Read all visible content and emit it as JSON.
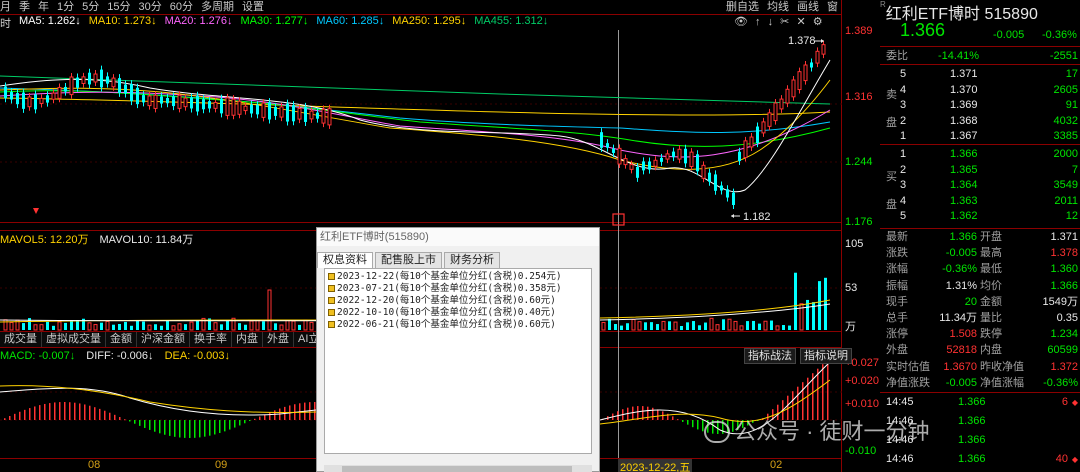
{
  "toolbar": {
    "items": [
      "月",
      "季",
      "年",
      "1分",
      "5分",
      "15分",
      "30分",
      "60分",
      "多周期",
      "设置"
    ],
    "right_items": [
      "删自选",
      "均线",
      "画线",
      "窗"
    ]
  },
  "ma": {
    "ma5": "MA5: 1.262↓",
    "ma10": "MA10: 1.273↓",
    "ma20": "MA20: 1.276↓",
    "ma30": "MA30: 1.277↓",
    "ma60": "MA60: 1.285↓",
    "ma250": "MA250: 1.295↓",
    "ma455": "MA455: 1.312↓",
    "prefix": "时",
    "colors": {
      "ma5": "#ffffff",
      "ma10": "#ffd200",
      "ma20": "#ff66ff",
      "ma30": "#00ff00",
      "ma60": "#00c8ff",
      "ma250": "#ffd200",
      "ma455": "#00cc66"
    }
  },
  "price_scale": {
    "p1": "1.389",
    "p2": "1.316",
    "p3": "1.244",
    "p4": "1.176"
  },
  "annotations": {
    "high": "1.378",
    "low": "1.182"
  },
  "volume": {
    "mavol5": "MAVOL5: 12.20万",
    "mavol10": "MAVOL10: 11.84万",
    "scale_top": "105",
    "scale_mid": "53",
    "unit": "万"
  },
  "indicator_tabs": [
    "成交量",
    "虚拟成交量",
    "金额",
    "沪深金额",
    "换手率",
    "内盘",
    "外盘",
    "AI立桩成"
  ],
  "macd": {
    "macd": "MACD: -0.007↓",
    "diff": "DIFF: -0.006↓",
    "dea": "DEA: -0.003↓",
    "btn1": "指标战法",
    "btn2": "指标说明",
    "scale": [
      "+0.027",
      "+0.020",
      "+0.010",
      "-0.010"
    ]
  },
  "date_axis": {
    "d1": "08",
    "d2": "09",
    "d3": "2023-12-22,五",
    "d4": "02"
  },
  "quote": {
    "name": "红利ETF博时",
    "code": "515890",
    "price": "1.366",
    "change": "-0.005",
    "pct": "-0.36%",
    "weibi_label": "委比",
    "weibi": "-14.41%",
    "weicha": "-2551",
    "sell_label1": "卖",
    "sell_label2": "盘",
    "buy_label1": "买",
    "buy_label2": "盘",
    "asks": [
      {
        "lvl": "5",
        "price": "1.371",
        "vol": "17"
      },
      {
        "lvl": "4",
        "price": "1.370",
        "vol": "2605"
      },
      {
        "lvl": "3",
        "price": "1.369",
        "vol": "91"
      },
      {
        "lvl": "2",
        "price": "1.368",
        "vol": "4032"
      },
      {
        "lvl": "1",
        "price": "1.367",
        "vol": "3385"
      }
    ],
    "bids": [
      {
        "lvl": "1",
        "price": "1.366",
        "vol": "2000"
      },
      {
        "lvl": "2",
        "price": "1.365",
        "vol": "7"
      },
      {
        "lvl": "3",
        "price": "1.364",
        "vol": "3549"
      },
      {
        "lvl": "4",
        "price": "1.363",
        "vol": "2011"
      },
      {
        "lvl": "5",
        "price": "1.362",
        "vol": "12"
      }
    ],
    "stats": [
      {
        "l1": "最新",
        "v1": "1.366",
        "c1": "green",
        "l2": "开盘",
        "v2": "1.371",
        "c2": "white"
      },
      {
        "l1": "涨跌",
        "v1": "-0.005",
        "c1": "green",
        "l2": "最高",
        "v2": "1.378",
        "c2": "red"
      },
      {
        "l1": "涨幅",
        "v1": "-0.36%",
        "c1": "green",
        "l2": "最低",
        "v2": "1.360",
        "c2": "green"
      },
      {
        "l1": "振幅",
        "v1": "1.31%",
        "c1": "white",
        "l2": "均价",
        "v2": "1.366",
        "c2": "green"
      },
      {
        "l1": "现手",
        "v1": "20",
        "c1": "green",
        "l2": "金额",
        "v2": "1549万",
        "c2": "white"
      },
      {
        "l1": "总手",
        "v1": "11.34万",
        "c1": "white",
        "l2": "量比",
        "v2": "0.35",
        "c2": "white"
      },
      {
        "l1": "涨停",
        "v1": "1.508",
        "c1": "red",
        "l2": "跌停",
        "v2": "1.234",
        "c2": "green"
      },
      {
        "l1": "外盘",
        "v1": "52818",
        "c1": "red",
        "l2": "内盘",
        "v2": "60599",
        "c2": "green"
      },
      {
        "l1": "实时估值",
        "v1": "1.3670",
        "c1": "red",
        "l2": "昨收净值",
        "v2": "1.372",
        "c2": "red"
      },
      {
        "l1": "净值涨跌",
        "v1": "-0.005",
        "c1": "green",
        "l2": "净值涨幅",
        "v2": "-0.36%",
        "c2": "green"
      }
    ],
    "ticks": [
      {
        "t": "14:45",
        "p": "1.366",
        "v": "6",
        "d": "◆"
      },
      {
        "t": "14:46",
        "p": "1.366",
        "v": "",
        "d": ""
      },
      {
        "t": "14:46",
        "p": "1.366",
        "v": "",
        "d": ""
      },
      {
        "t": "14:46",
        "p": "1.366",
        "v": "40",
        "d": "◆"
      }
    ]
  },
  "popup": {
    "title": "红利ETF博时(515890)",
    "tabs": [
      "权息资料",
      "配售股上市",
      "财务分析"
    ],
    "items": [
      "2023-12-22(每10个基金单位分红(含税)0.254元)",
      "2023-07-21(每10个基金单位分红(含税)0.358元)",
      "2022-12-20(每10个基金单位分红(含税)0.60元)",
      "2022-10-10(每10个基金单位分红(含税)0.40元)",
      "2022-06-21(每10个基金单位分红(含税)0.60元)"
    ]
  },
  "watermark": "公众号 · 徒财一分钟"
}
